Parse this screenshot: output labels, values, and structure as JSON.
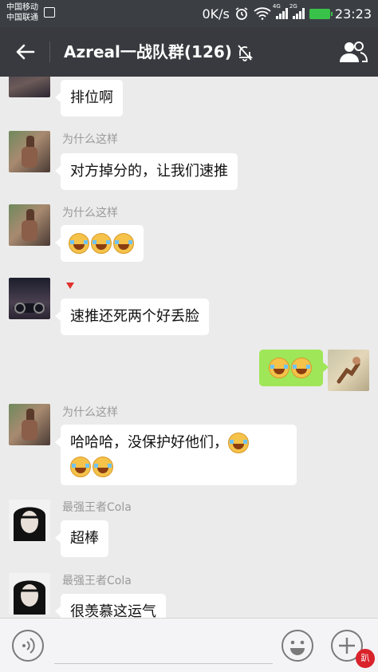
{
  "status_bar": {
    "carrier_1": "中国移动",
    "carrier_2": "中国联通",
    "net_speed": "0K/s",
    "sig1_label": "4G",
    "sig2_label": "2G",
    "time": "23:23",
    "battery_color": "#39c24a"
  },
  "header": {
    "title": "Azreal一战队群(126)",
    "back_icon": "arrow-left-icon",
    "mute_icon": "bell-off-icon",
    "group_icon": "group-members-icon"
  },
  "messages": [
    {
      "side": "in",
      "nickname": "",
      "text": "排位啊"
    },
    {
      "side": "in",
      "nickname": "为什么这样",
      "text": "对方掉分的，让我们速推"
    },
    {
      "side": "in",
      "nickname": "为什么这样",
      "text": "",
      "emojis": [
        "cry-laugh",
        "cry-laugh",
        "cry-laugh"
      ]
    },
    {
      "side": "in",
      "nickname": "",
      "text": "速推还死两个好丢脸"
    },
    {
      "side": "out",
      "nickname": "",
      "text": "",
      "emojis": [
        "tears-of-joy",
        "tears-of-joy"
      ]
    },
    {
      "side": "in",
      "nickname": "为什么这样",
      "text": "哈哈哈，没保护好他们，",
      "emojis": [
        "tears-of-joy",
        "tears-of-joy",
        "tears-of-joy"
      ]
    },
    {
      "side": "in",
      "nickname": "最强王者Cola",
      "text": "超棒"
    },
    {
      "side": "in",
      "nickname": "最强王者Cola",
      "text": "很羡慕这运气"
    }
  ],
  "input_bar": {
    "voice_icon": "voice-icon",
    "emoji_icon": "smiley-icon",
    "plus_icon": "plus-icon",
    "badge_text": "趴",
    "input_value": ""
  },
  "colors": {
    "header_bg": "#393a3f",
    "chat_bg": "#ebebeb",
    "outgoing_bubble": "#9fe658",
    "incoming_bubble": "#ffffff"
  }
}
